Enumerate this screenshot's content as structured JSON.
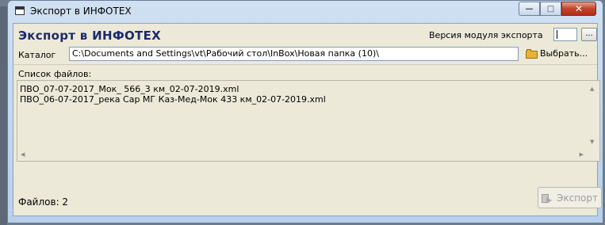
{
  "window": {
    "title": "Экспорт в ИНФОТЕХ",
    "buttons": {
      "minimize": "—",
      "maximize": "□",
      "close": "✕"
    }
  },
  "header": {
    "title": "Экспорт в ИНФОТЕХ",
    "version_label": "Версия модуля экспорта",
    "version_value": "",
    "browse_label": "..."
  },
  "catalog": {
    "label": "Каталог",
    "value": "C:\\Documents and Settings\\vt\\Рабочий стол\\InBox\\Новая папка (10)\\",
    "choose_label": "Выбрать..."
  },
  "files": {
    "label": "Список файлов:",
    "items": [
      "ПВО_07-07-2017_Мок_ 566_3 км_02-07-2019.xml",
      "ПВО_06-07-2017_река Сар МГ Каз-Мед-Мок 433 км_02-07-2019.xml"
    ]
  },
  "status": {
    "count_text": "Файлов: 2"
  },
  "actions": {
    "export_label": "Экспорт"
  }
}
